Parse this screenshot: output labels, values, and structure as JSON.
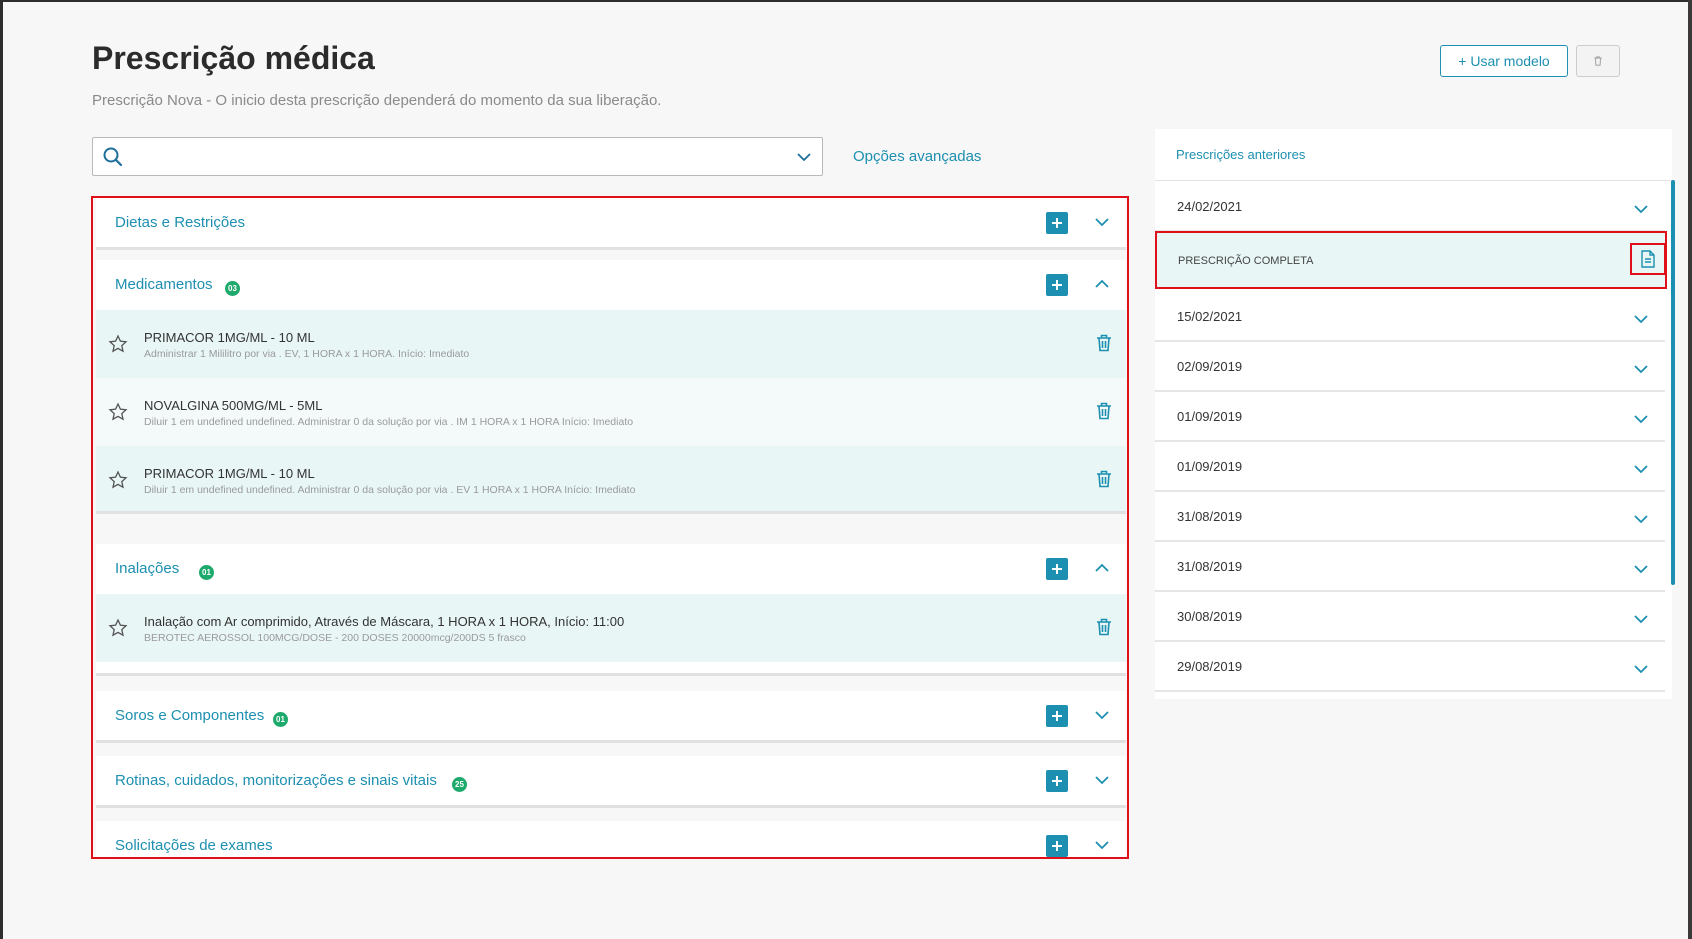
{
  "header": {
    "title": "Prescrição médica",
    "subtitle": "Prescrição Nova - O inicio desta prescrição dependerá do momento da sua liberação.",
    "use_model_label": "+ Usar modelo"
  },
  "search": {
    "placeholder": "",
    "advanced_options_label": "Opções avançadas"
  },
  "sections": {
    "dietas": {
      "title": "Dietas e Restrições"
    },
    "medicamentos": {
      "title": "Medicamentos",
      "count": "03",
      "items": [
        {
          "title": "PRIMACOR 1MG/ML - 10 ML",
          "detail": "Administrar 1 Mililitro por via . EV, 1 HORA x 1 HORA. Início: Imediato"
        },
        {
          "title": "NOVALGINA 500MG/ML - 5ML",
          "detail": "Diluir 1 em undefined undefined. Administrar 0 da solução por via . IM 1 HORA x 1 HORA Início: Imediato"
        },
        {
          "title": "PRIMACOR 1MG/ML - 10 ML",
          "detail": "Diluir 1 em undefined undefined. Administrar 0 da solução por via . EV 1 HORA x 1 HORA Início: Imediato"
        }
      ]
    },
    "inalacoes": {
      "title": "Inalações",
      "count": "01",
      "items": [
        {
          "title": "Inalação com Ar comprimido, Através de Máscara, 1 HORA x 1 HORA, Início: 11:00",
          "detail": "BEROTEC AEROSSOL 100MCG/DOSE - 200 DOSES 20000mcg/200DS 5 frasco"
        }
      ]
    },
    "soros": {
      "title": "Soros e Componentes",
      "count": "01"
    },
    "rotinas": {
      "title": "Rotinas, cuidados, monitorizações e sinais vitais",
      "count": "25"
    },
    "exames": {
      "title": "Solicitações de exames"
    }
  },
  "previous": {
    "title": "Prescrições anteriores",
    "complete_label": "PRESCRIÇÃO COMPLETA",
    "dates": [
      "24/02/2021",
      "15/02/2021",
      "02/09/2019",
      "01/09/2019",
      "01/09/2019",
      "31/08/2019",
      "31/08/2019",
      "30/08/2019",
      "29/08/2019"
    ]
  },
  "colors": {
    "accent": "#1d8fb0",
    "badge": "#1faa6d",
    "highlight_border": "#e0101a",
    "item_bg": "#e9f6f6"
  }
}
